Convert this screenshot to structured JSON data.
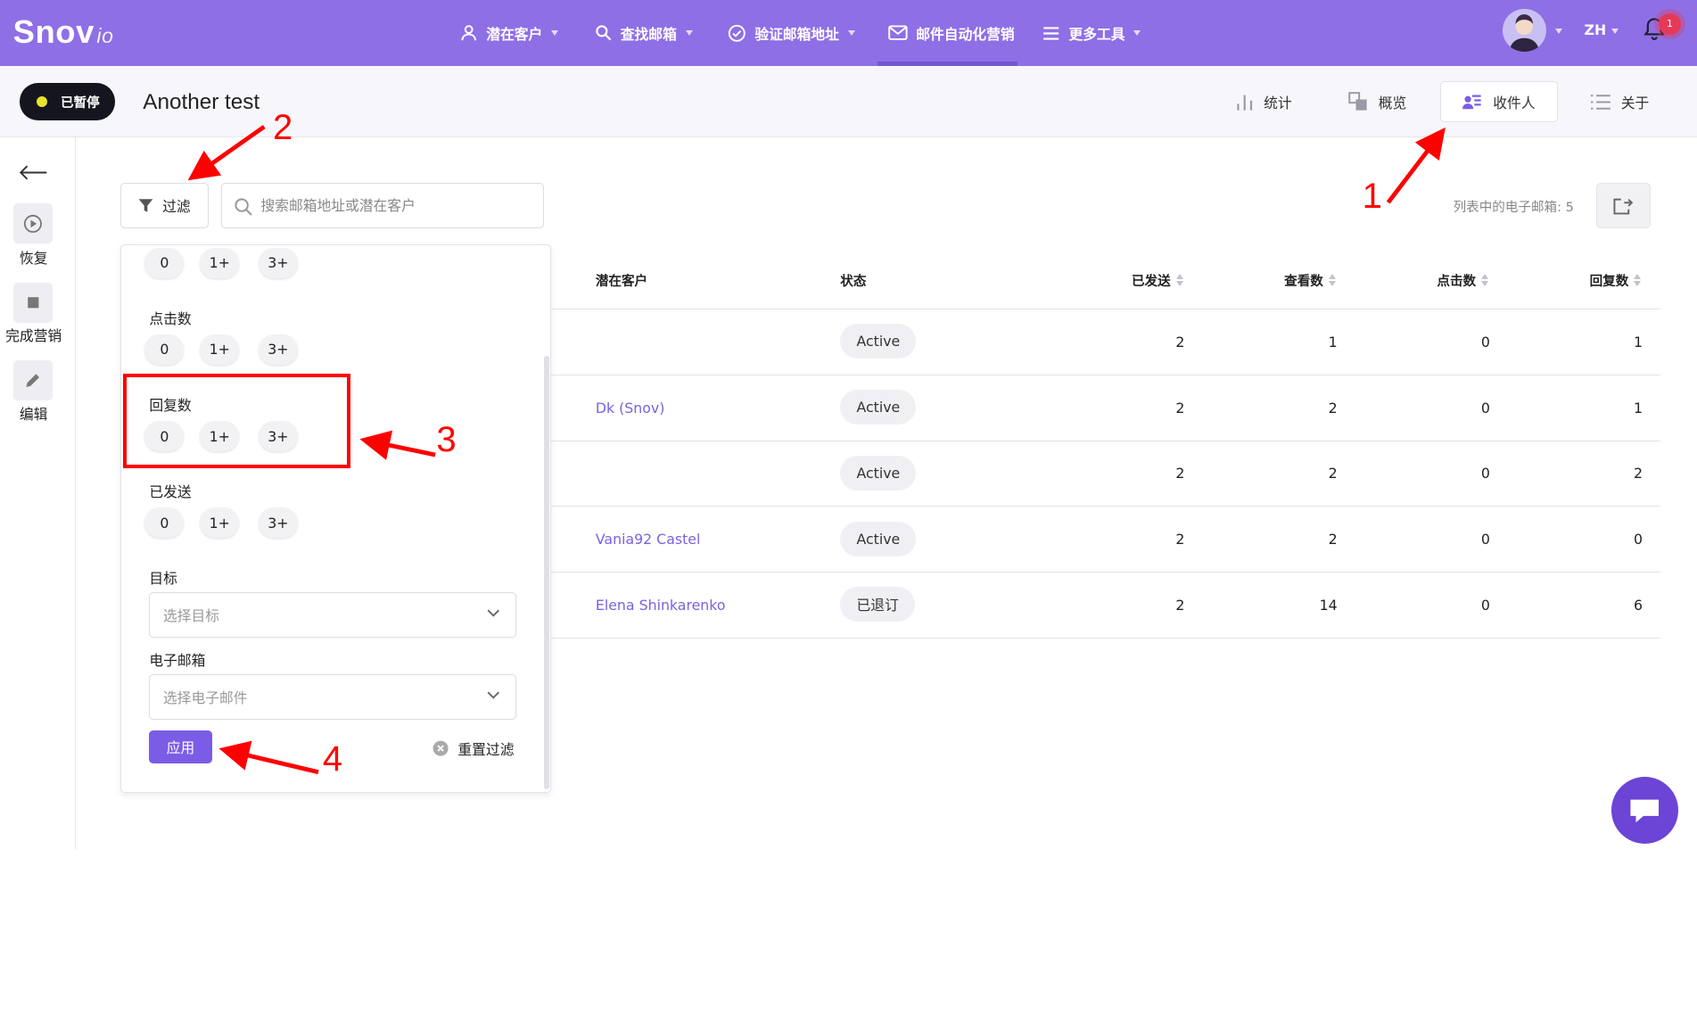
{
  "app": {
    "logo_main": "Snov",
    "logo_suffix": "io"
  },
  "nav": {
    "items": [
      {
        "label": "潜在客户",
        "icon": "user-icon"
      },
      {
        "label": "查找邮箱",
        "icon": "search-icon"
      },
      {
        "label": "验证邮箱地址",
        "icon": "check-circle-icon"
      },
      {
        "label": "邮件自动化营销",
        "icon": "mail-icon"
      },
      {
        "label": "更多工具",
        "icon": "menu-icon"
      }
    ],
    "lang": "ZH",
    "notifications": "1"
  },
  "campaign": {
    "status": "已暂停",
    "title": "Another test",
    "tabs": [
      "统计",
      "概览",
      "收件人",
      "关于"
    ],
    "active_tab": "收件人"
  },
  "sidebar": {
    "items": [
      "恢复",
      "完成营销",
      "编辑"
    ]
  },
  "toolbar": {
    "filter_label": "过滤",
    "search_placeholder": "搜索邮箱地址或潜在客户",
    "email_count": "列表中的电子邮箱: 5"
  },
  "filter_panel": {
    "groups": [
      {
        "label": "",
        "options": [
          "0",
          "1+",
          "3+"
        ]
      },
      {
        "label": "点击数",
        "options": [
          "0",
          "1+",
          "3+"
        ]
      },
      {
        "label": "回复数",
        "options": [
          "0",
          "1+",
          "3+"
        ]
      },
      {
        "label": "已发送",
        "options": [
          "0",
          "1+",
          "3+"
        ]
      }
    ],
    "goal_label": "目标",
    "goal_placeholder": "选择目标",
    "email_label": "电子邮箱",
    "email_placeholder": "选择电子邮件",
    "apply_label": "应用",
    "reset_label": "重置过滤"
  },
  "table": {
    "headers": [
      "潜在客户",
      "状态",
      "已发送",
      "查看数",
      "点击数",
      "回复数"
    ],
    "rows": [
      {
        "prospect": "",
        "status": "Active",
        "sent": "2",
        "views": "1",
        "clicks": "0",
        "replies": "1"
      },
      {
        "prospect": "Dk (Snov)",
        "status": "Active",
        "sent": "2",
        "views": "2",
        "clicks": "0",
        "replies": "1"
      },
      {
        "prospect": "",
        "status": "Active",
        "sent": "2",
        "views": "2",
        "clicks": "0",
        "replies": "2"
      },
      {
        "prospect": "Vania92 Castel",
        "status": "Active",
        "sent": "2",
        "views": "2",
        "clicks": "0",
        "replies": "0"
      },
      {
        "prospect": "Elena Shinkarenko",
        "status": "已退订",
        "sent": "2",
        "views": "14",
        "clicks": "0",
        "replies": "6"
      }
    ]
  },
  "annotations": {
    "labels": [
      "1",
      "2",
      "3",
      "4"
    ],
    "color": "#ff0000"
  },
  "colors": {
    "brand": "#8e6fe6",
    "accent": "#7b5ce6",
    "link": "#7b62e0",
    "badge": "#e53958"
  }
}
